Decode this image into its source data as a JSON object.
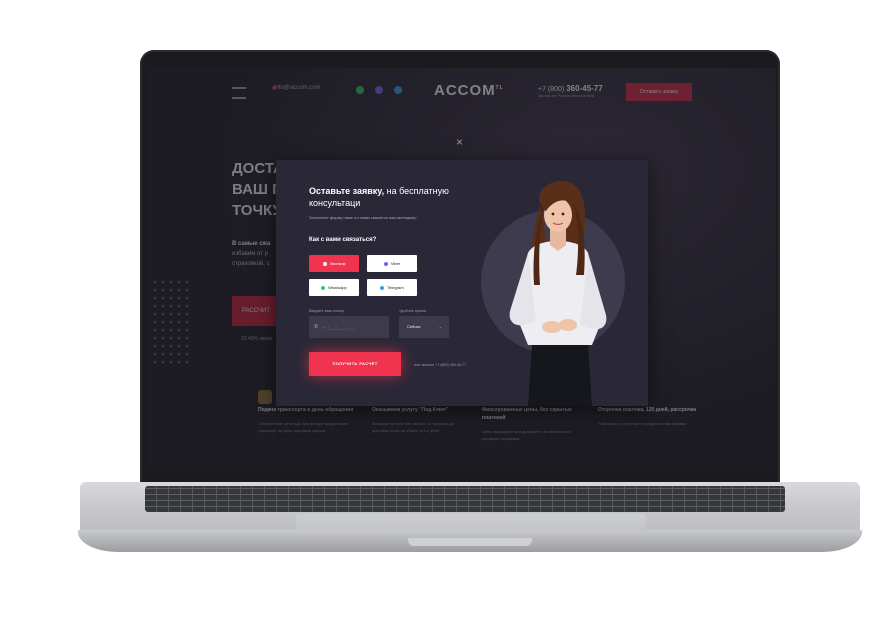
{
  "site": {
    "email": "info@accom.com",
    "logo": "ACCOM",
    "logo_sup": "TL",
    "phone_prefix": "+7 (800)",
    "phone_number": "360-45-77",
    "phone_caption": "Звонок по России бесплатный",
    "header_button": "Оставить заявку",
    "hero_lines": [
      "ДОСТА",
      "ВАШ Г",
      "ТОЧКУ"
    ],
    "hero_sub_lead": "В самые сжа",
    "hero_sub_lines": [
      "избавим от р",
      "страховкой, с"
    ],
    "hero_button": "РАССЧИТ",
    "hero_note": "20 40% эконо",
    "features": [
      {
        "title": "Подача транспорта в день обращения",
        "text": "Собственные автопарк. Мы всегда предоставим транспорт на день под ваши задачи"
      },
      {
        "title": "Оказываем услугу \"Под Ключ\"",
        "text": "Возьмем на себя все заботы: от погрузки до доставки груза на объект в 3-х дней"
      },
      {
        "title": "Фиксированные цены, без скрытых платежей",
        "text": "Цены фиксируются в договоре и не меняются в процессе перевозки"
      },
      {
        "title": "Отсрочка платежа, 120 дней, рассрочка",
        "text": "Работаем по отсрочке с юридическими лицами"
      }
    ],
    "social_colors": [
      "#25d366",
      "#7360f2",
      "#2ca5e0"
    ],
    "brand_red": "#d11f39"
  },
  "modal": {
    "close_icon": "×",
    "title_bold": "Оставьте заявку,",
    "title_rest": " на бесплатную консультаци",
    "subtitle": "Заполните форму ниже и с вами свяжется наш менеджер",
    "question": "Как с вами связаться?",
    "options": [
      {
        "label": "Звонком",
        "icon": "phone-icon",
        "color": "#ffffff",
        "active": true
      },
      {
        "label": "Viber",
        "icon": "viber-icon",
        "color": "#7360f2",
        "active": false
      },
      {
        "label": "WhatsApp",
        "icon": "whatsapp-icon",
        "color": "#25d366",
        "active": false
      },
      {
        "label": "Telegram",
        "icon": "telegram-icon",
        "color": "#2ca5e0",
        "active": false
      }
    ],
    "phone_label": "Введите ваш номер",
    "phone_placeholder": "+7 (___) ___-__-__",
    "time_label": "Удобное время",
    "time_value": "Сейчас",
    "submit_label": "ПОЛУЧИТЬ РАСЧЁТ",
    "consent_text": "или звоните +7 (800) 360-45-77",
    "accent": "#f0334f"
  }
}
